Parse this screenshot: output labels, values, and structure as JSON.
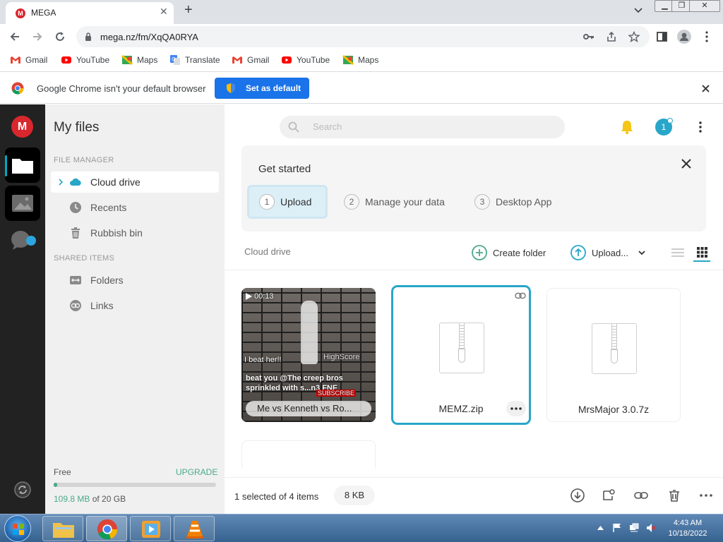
{
  "browser": {
    "tab_title": "MEGA",
    "url": "mega.nz/fm/XqQA0RYA",
    "bookmarks": [
      "Gmail",
      "YouTube",
      "Maps",
      "Translate",
      "Gmail",
      "YouTube",
      "Maps"
    ]
  },
  "infobar": {
    "message": "Google Chrome isn't your default browser",
    "button": "Set as default"
  },
  "rail": {
    "logo": "M"
  },
  "sidebar": {
    "title": "My files",
    "section_file_manager": "FILE MANAGER",
    "items": [
      {
        "label": "Cloud drive",
        "icon": "cloud-icon"
      },
      {
        "label": "Recents",
        "icon": "clock-icon"
      },
      {
        "label": "Rubbish bin",
        "icon": "trash-icon"
      }
    ],
    "section_shared": "SHARED ITEMS",
    "shared": [
      {
        "label": "Folders",
        "icon": "shared-folder-icon"
      },
      {
        "label": "Links",
        "icon": "link-icon"
      }
    ],
    "plan": "Free",
    "upgrade": "UPGRADE",
    "storage_used": "109.8 MB",
    "storage_total": "of 20 GB",
    "storage_fraction": 0.005
  },
  "header": {
    "search_placeholder": "Search",
    "avatar_initial": "1"
  },
  "get_started": {
    "title": "Get started",
    "steps": [
      {
        "num": "1",
        "label": "Upload"
      },
      {
        "num": "2",
        "label": "Manage your data"
      },
      {
        "num": "3",
        "label": "Desktop App"
      }
    ]
  },
  "toolbar": {
    "breadcrumb": "Cloud drive",
    "create_folder": "Create folder",
    "upload": "Upload..."
  },
  "files": [
    {
      "name": "Me vs Kenneth vs Ro...",
      "type": "video",
      "duration": "00:13",
      "overlay_lines": [
        "I beat her!!",
        "beat you @The creep bros",
        "sprinkled with s...n3 FNF",
        "SUBSCRIBE",
        "HighScore"
      ]
    },
    {
      "name": "MEMZ.zip",
      "type": "zip",
      "selected": true
    },
    {
      "name": "MrsMajor 3.0.7z",
      "type": "zip",
      "selected": false
    }
  ],
  "status": {
    "selection": "1 selected of 4 items",
    "size": "8 KB"
  },
  "taskbar": {
    "time": "4:43 AM",
    "date": "10/18/2022"
  },
  "colors": {
    "mega_red": "#d9272e",
    "accent_teal": "#28a6c8",
    "upgrade_green": "#4aab87",
    "chrome_blue": "#1a73e8"
  }
}
